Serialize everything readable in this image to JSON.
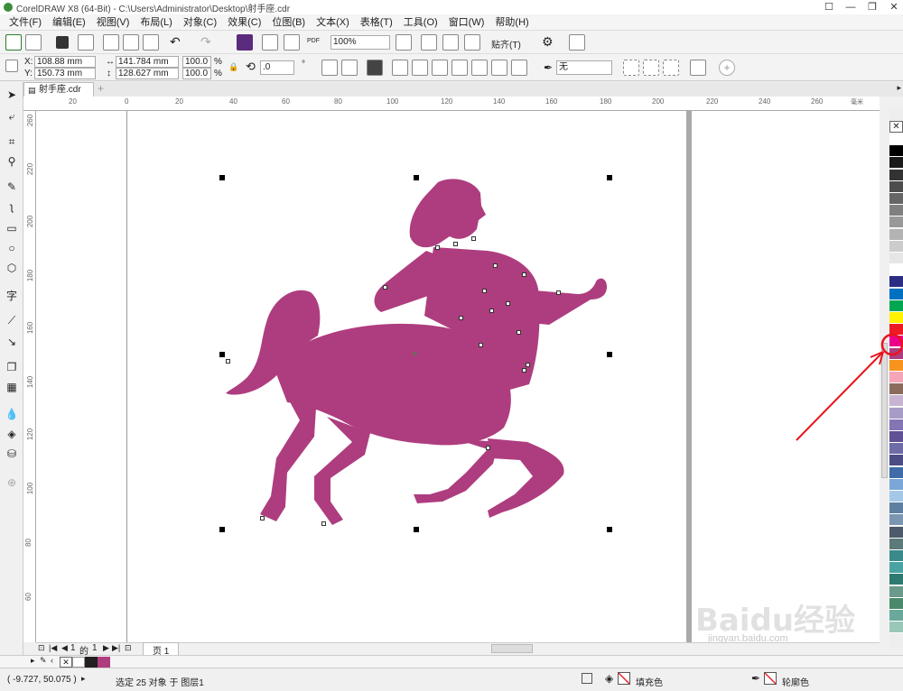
{
  "window": {
    "title": "CorelDRAW X8 (64-Bit) - C:\\Users\\Administrator\\Desktop\\射手座.cdr",
    "minimize": "—",
    "restore": "❐",
    "close": "✕"
  },
  "menu": [
    "文件(F)",
    "编辑(E)",
    "视图(V)",
    "布局(L)",
    "对象(C)",
    "效果(C)",
    "位图(B)",
    "文本(X)",
    "表格(T)",
    "工具(O)",
    "窗口(W)",
    "帮助(H)"
  ],
  "toolbar": {
    "zoom": "100%",
    "snap_label": "贴齐(T)"
  },
  "properties": {
    "x_label": "X:",
    "x_value": "108.88 mm",
    "y_label": "Y:",
    "y_value": "150.73 mm",
    "width": "141.784 mm",
    "height": "128.627 mm",
    "scale_w": "100.0",
    "scale_h": "100.0",
    "percent": "%",
    "rotation": ".0",
    "degree": "°",
    "outline": "无"
  },
  "document_tab": "射手座.cdr",
  "ruler": {
    "h": [
      "20",
      "0",
      "20",
      "40",
      "60",
      "80",
      "100",
      "120",
      "140",
      "160",
      "180",
      "200",
      "220",
      "240",
      "260"
    ],
    "h_unit": "毫米",
    "v": [
      "260",
      "220",
      "200",
      "180",
      "160",
      "140",
      "120",
      "100",
      "80",
      "60"
    ]
  },
  "page_nav": {
    "current": "1",
    "of_label": "的",
    "total": "1",
    "page_tab": "页 1"
  },
  "status": {
    "coords": "( -9.727, 50.075 )",
    "selection": "选定 25 对象 于 图层1",
    "fill_label": "填充色",
    "outline_label": "轮廓色"
  },
  "colors": {
    "shape_fill": "#ae3d7f",
    "annotation": "#e8141b",
    "palette": [
      "#ffffff",
      "#000000",
      "#1a1a1a",
      "#333333",
      "#4d4d4d",
      "#666666",
      "#808080",
      "#999999",
      "#b3b3b3",
      "#cccccc",
      "#e6e6e6",
      "#ffffff",
      "#2b2e83",
      "#0070c0",
      "#00a651",
      "#fff200",
      "#ed1c24",
      "#ec008c",
      "#ae3d7f",
      "#f7941d",
      "#f4a5b8",
      "#8b6c5c",
      "#c8b4d2",
      "#a79bc8",
      "#8475b4",
      "#5f5194",
      "#6f6ba7",
      "#4b4d84",
      "#3f6ca8",
      "#7aa6d8",
      "#a6c8e8",
      "#5e7fa0",
      "#7a96b0",
      "#4c5a6c",
      "#5c7a7a",
      "#3a8a8a",
      "#4aa3a3",
      "#2e7a70",
      "#6a9a8a",
      "#4a8a6a",
      "#6aa89a",
      "#9ac8b8"
    ]
  },
  "watermark": {
    "brand": "Baidu经验",
    "url": "jingyan.baidu.com"
  }
}
